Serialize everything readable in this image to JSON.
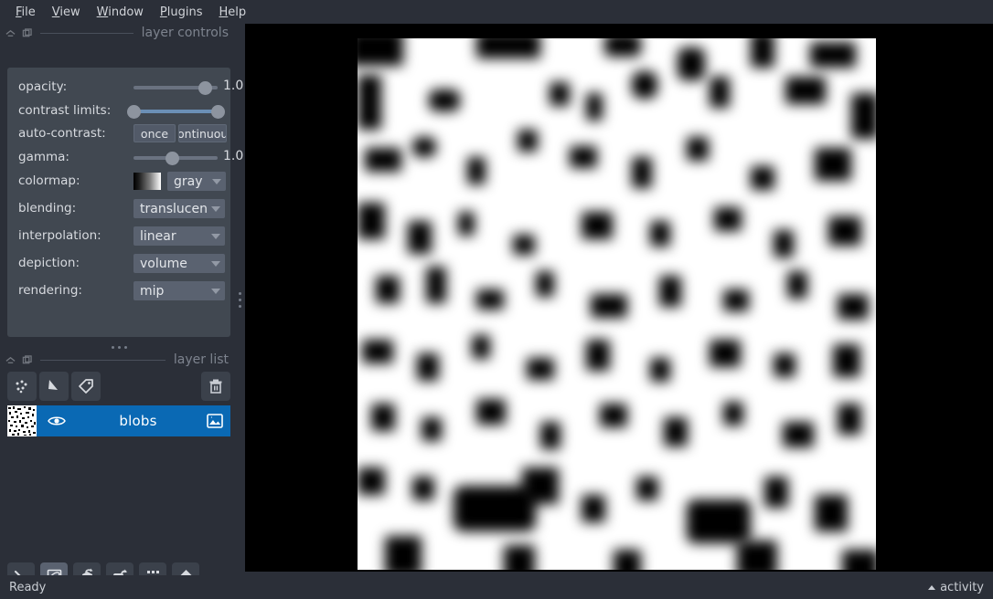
{
  "menubar": {
    "items": [
      {
        "label": "File",
        "mnemonic": "F"
      },
      {
        "label": "View",
        "mnemonic": "V"
      },
      {
        "label": "Window",
        "mnemonic": "W"
      },
      {
        "label": "Plugins",
        "mnemonic": "P"
      },
      {
        "label": "Help",
        "mnemonic": "H"
      }
    ]
  },
  "layer_controls": {
    "title": "layer controls",
    "float_icon": "undock-icon",
    "close_icon": "close-icon",
    "rows": {
      "opacity": {
        "label": "opacity:",
        "value": "1.0",
        "knob_percent": 85
      },
      "contrast_limits": {
        "label": "contrast limits:",
        "low_percent": 0,
        "high_percent": 100
      },
      "auto_contrast": {
        "label": "auto-contrast:",
        "once_label": "once",
        "continuous_label": "continuous"
      },
      "gamma": {
        "label": "gamma:",
        "value": "1.0",
        "knob_percent": 46
      },
      "colormap": {
        "label": "colormap:",
        "value": "gray",
        "swatch": "gray-gradient-swatch"
      },
      "blending": {
        "label": "blending:",
        "value": "translucent"
      },
      "interpolation": {
        "label": "interpolation:",
        "value": "linear"
      },
      "depiction": {
        "label": "depiction:",
        "value": "volume"
      },
      "rendering": {
        "label": "rendering:",
        "value": "mip"
      }
    }
  },
  "layer_list": {
    "title": "layer list",
    "float_icon": "undock-icon",
    "close_icon": "close-icon",
    "buttons": [
      {
        "name": "new-points-layer-button",
        "icon": "points-icon"
      },
      {
        "name": "new-shapes-layer-button",
        "icon": "shapes-icon"
      },
      {
        "name": "new-labels-layer-button",
        "icon": "labels-icon"
      },
      {
        "name": "delete-layer-button",
        "icon": "trash-icon"
      }
    ],
    "layers": [
      {
        "name": "blobs",
        "visible": true,
        "selected": true,
        "type_icon": "image-layer-icon",
        "visibility_icon": "eye-icon",
        "thumbnail": "noise-thumbnail"
      }
    ]
  },
  "viewer_buttons": [
    {
      "name": "console-button",
      "icon": "console-icon",
      "active": false
    },
    {
      "name": "ndisplay-toggle-button",
      "icon": "cube-3d-icon",
      "active": true
    },
    {
      "name": "roll-dims-button",
      "icon": "roll-cube-icon",
      "active": false
    },
    {
      "name": "transpose-dims-button",
      "icon": "transpose-icon",
      "active": false
    },
    {
      "name": "grid-view-button",
      "icon": "grid-icon",
      "active": false
    },
    {
      "name": "reset-view-button",
      "icon": "home-icon",
      "active": false
    }
  ],
  "canvas": {
    "layer_displayed": "blobs",
    "background": "#000000",
    "image_background": "#ffffff",
    "image_foreground": "#000000"
  },
  "statusbar": {
    "status": "Ready",
    "activity_label": "activity",
    "activity_caret": "caret-up-icon"
  }
}
